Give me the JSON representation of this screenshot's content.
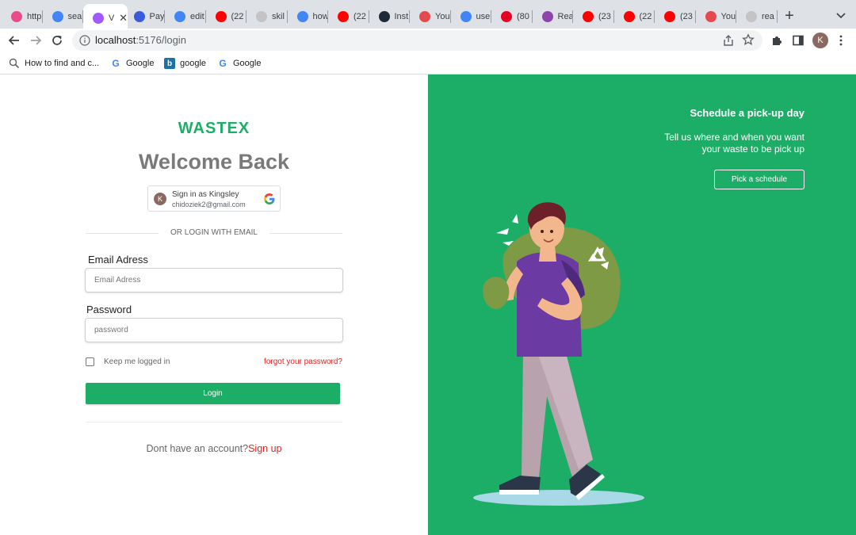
{
  "browser": {
    "tabs": [
      {
        "title": "http",
        "icon": "dribbble-icon",
        "color": "#ea4c89"
      },
      {
        "title": "sea",
        "icon": "google-icon",
        "color": "#4285f4"
      },
      {
        "title": "V",
        "icon": "vite-icon",
        "color": "#a259ff",
        "active": true
      },
      {
        "title": "Pay",
        "icon": "paystack-icon",
        "color": "#3b5bdb"
      },
      {
        "title": "edit",
        "icon": "google-icon",
        "color": "#4285f4"
      },
      {
        "title": "(22",
        "icon": "youtube-icon",
        "color": "#ff0000"
      },
      {
        "title": "skil",
        "icon": "github-icon",
        "color": "#c4c4c4"
      },
      {
        "title": "how",
        "icon": "google-icon",
        "color": "#4285f4"
      },
      {
        "title": "(22",
        "icon": "youtube-icon",
        "color": "#ff0000"
      },
      {
        "title": "Inst",
        "icon": "react-icon",
        "color": "#1f2937"
      },
      {
        "title": "You",
        "icon": "download-icon",
        "color": "#e5484d"
      },
      {
        "title": "use",
        "icon": "google-icon",
        "color": "#4285f4"
      },
      {
        "title": "(80",
        "icon": "pinterest-icon",
        "color": "#e60023"
      },
      {
        "title": "Rea",
        "icon": "reader-icon",
        "color": "#8e44ad"
      },
      {
        "title": "(23",
        "icon": "youtube-icon",
        "color": "#ff0000"
      },
      {
        "title": "(22",
        "icon": "youtube-icon",
        "color": "#ff0000"
      },
      {
        "title": "(23",
        "icon": "youtube-icon",
        "color": "#ff0000"
      },
      {
        "title": "You",
        "icon": "download-icon",
        "color": "#e5484d"
      },
      {
        "title": "rea",
        "icon": "globe-icon",
        "color": "#c4c4c4"
      }
    ],
    "url_host": "localhost",
    "url_path": ":5176/login",
    "profile_initial": "K",
    "bookmarks": [
      {
        "label": "How to find and c...",
        "icon": "search-icon"
      },
      {
        "label": "Google",
        "icon": "google-icon"
      },
      {
        "label": "google",
        "icon": "bing-icon"
      },
      {
        "label": "Google",
        "icon": "google-icon"
      }
    ]
  },
  "login": {
    "brand": "WASTEX",
    "heading": "Welcome Back",
    "google": {
      "avatar_initial": "K",
      "name_line": "Sign in as Kingsley",
      "email": "chidoziek2@gmail.com"
    },
    "divider_text": "OR LOGIN WITH EMAIL",
    "email_label": "Email Adress",
    "email_placeholder": "Email Adress",
    "password_label": "Password",
    "password_placeholder": "password",
    "keep_logged_in": "Keep me logged in",
    "forgot": "forgot your password?",
    "login_button": "Login",
    "no_account": "Dont have an account?",
    "signup": "Sign up"
  },
  "promo": {
    "title": "Schedule a pick-up day",
    "subtitle_line1": "Tell us where and when you want",
    "subtitle_line2": "your waste to be pick up",
    "button": "Pick a schedule"
  },
  "colors": {
    "brand_green": "#1cae67",
    "link_red": "#e02424",
    "heading_gray": "#7a7a7a"
  }
}
